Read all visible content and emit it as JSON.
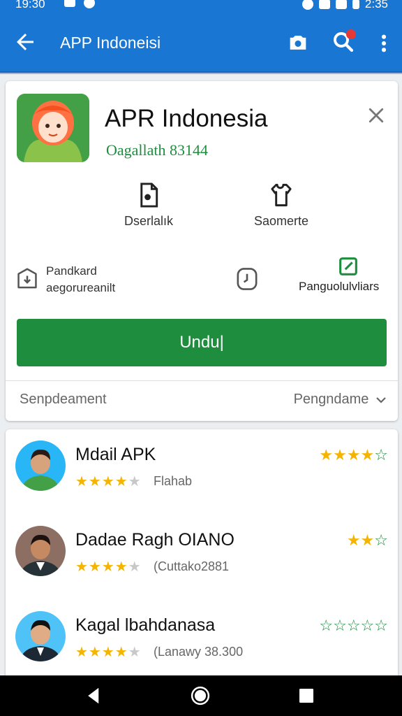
{
  "status_bar": {
    "time": "19:30",
    "right_time": "2:35"
  },
  "app_bar": {
    "title": "APP Indoneisi"
  },
  "app": {
    "name": "APR Indonesia",
    "developer": "Oagallath 83144"
  },
  "actions": [
    {
      "label": "Dserlalık",
      "icon": "document-icon"
    },
    {
      "label": "Saomerte",
      "icon": "shirt-icon"
    }
  ],
  "info": {
    "left_line1": "Pandkard",
    "left_line2": "aegorureanilt",
    "right_label": "Panguolulvliars"
  },
  "install_button": "Undu|",
  "footer": {
    "left": "Senpdeament",
    "right": "Pengndame"
  },
  "reviews": [
    {
      "name": "Mdail APK",
      "meta": "Flahab",
      "stars": 4,
      "rating": "★★★★☆"
    },
    {
      "name": "Dadae Ragh OIANO",
      "meta": "(Cuttako2881",
      "stars": 4,
      "rating": "★★☆"
    },
    {
      "name": "Kagal lbahdanasa",
      "meta": "(Lanawy 38.300",
      "stars": 4,
      "rating": "☆☆☆☆☆"
    }
  ],
  "colors": {
    "primary": "#1976d2",
    "accent_green": "#1e8e3e",
    "star": "#f4b400"
  }
}
